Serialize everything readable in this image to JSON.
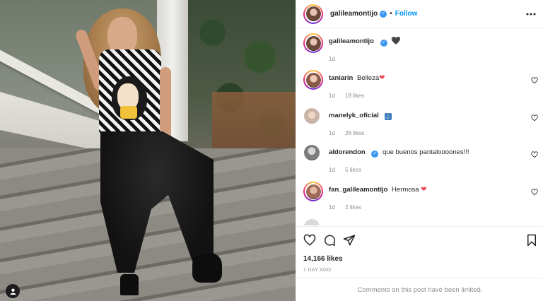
{
  "post": {
    "author": "galileamontijo",
    "follow_label": "Follow",
    "separator": "•",
    "caption_emoji": "🖤",
    "caption_time": "1d",
    "likes": "14,166 likes",
    "date": "1 DAY AGO",
    "comments_limited": "Comments on this post have been limited."
  },
  "comments": [
    {
      "username": "taniarin",
      "text": "Belleza",
      "emoji": "❤",
      "time": "1d",
      "likes": "18 likes"
    },
    {
      "username": "manelyk_oficial",
      "text": "",
      "emoji": "⚓",
      "time": "1d",
      "likes": "26 likes"
    },
    {
      "username": "aldorendon",
      "verified": true,
      "text": "que buenos pantaloooones!!!",
      "time": "1d",
      "likes": "5 likes"
    },
    {
      "username": "fan_galileamontijo",
      "text": "Hermosa",
      "emoji": "❤",
      "time": "1d",
      "likes": "2 likes"
    }
  ],
  "icons": {
    "more": "more-options-icon",
    "like": "heart-icon",
    "comment": "comment-icon",
    "share": "send-icon",
    "save": "bookmark-icon",
    "tag": "user-tag-icon"
  },
  "colors": {
    "link": "#0095f6",
    "verified": "#3897f0",
    "meta": "#8e8e8e",
    "heart_red": "#ed4956"
  }
}
